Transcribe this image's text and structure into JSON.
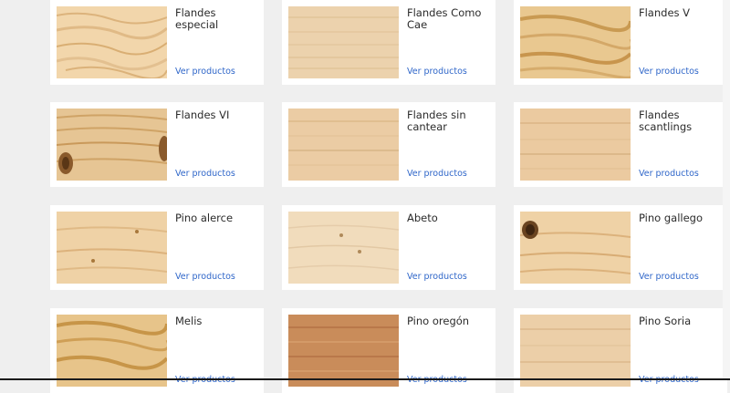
{
  "products": [
    {
      "name": "Flandes especial",
      "link": "Ver productos",
      "wood": "light-pine"
    },
    {
      "name": "Flandes Como Cae",
      "link": "Ver productos",
      "wood": "pale-straight"
    },
    {
      "name": "Flandes V",
      "link": "Ver productos",
      "wood": "golden-grain"
    },
    {
      "name": "Flandes VI",
      "link": "Ver productos",
      "wood": "knotty-grain"
    },
    {
      "name": "Flandes sin cantear",
      "link": "Ver productos",
      "wood": "pale-straight"
    },
    {
      "name": "Flandes scantlings",
      "link": "Ver productos",
      "wood": "pale-straight"
    },
    {
      "name": "Pino alerce",
      "link": "Ver productos",
      "wood": "larch"
    },
    {
      "name": "Abeto",
      "link": "Ver productos",
      "wood": "fir"
    },
    {
      "name": "Pino gallego",
      "link": "Ver productos",
      "wood": "knot-pine"
    },
    {
      "name": "Melis",
      "link": "Ver productos",
      "wood": "golden-grain"
    },
    {
      "name": "Pino oregón",
      "link": "Ver productos",
      "wood": "oregon"
    },
    {
      "name": "Pino Soria",
      "link": "Ver productos",
      "wood": "pale-straight"
    }
  ],
  "colors": {
    "background": "#efefef",
    "card": "#ffffff",
    "link": "#2f66c9",
    "title": "#2b2b2b"
  }
}
